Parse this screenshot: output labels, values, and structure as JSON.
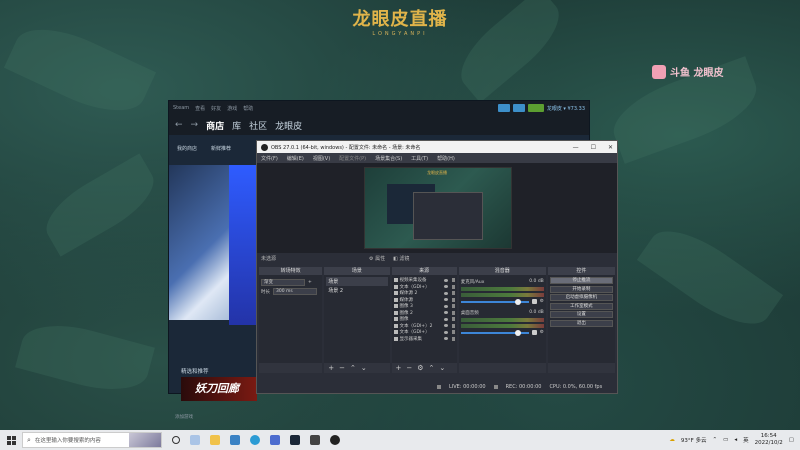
{
  "brand": {
    "title": "龙眼皮直播",
    "subtitle": "LONGYANPI"
  },
  "douyu": {
    "label": "斗鱼 龙眼皮"
  },
  "steam": {
    "menubar": [
      "Steam",
      "查看",
      "好友",
      "游戏",
      "帮助"
    ],
    "user_label": "龙眼皮 ▾ ¥73.33",
    "nav": {
      "back": "←",
      "forward": "→",
      "tabs": [
        "商店",
        "库",
        "社区",
        "龙眼皮"
      ]
    },
    "sub": [
      "我的商店",
      "新鲜推荐"
    ],
    "featured_label": "精选和推荐",
    "banner_text": "妖刀回廊",
    "add_game": "添加游戏"
  },
  "obs": {
    "title": "OBS 27.0.1 (64-bit, windows) - 配置文件: 未命名 - 场景: 未命名",
    "window_controls": [
      "—",
      "☐",
      "✕"
    ],
    "menu": [
      "文件(F)",
      "编辑(E)",
      "视图(V)",
      "配置文件(P)",
      "场景集合(S)",
      "工具(T)",
      "帮助(H)"
    ],
    "preview_title": "龙眼皮直播",
    "no_source": "未选源",
    "props": "⚙ 属性",
    "filters": "◧ 滤镜",
    "docks": {
      "transitions": {
        "title": "转场特效",
        "selected": "渐变",
        "duration_label": "时长",
        "duration_value": "300 ms"
      },
      "scenes": {
        "title": "场景",
        "items": [
          "场景",
          "场景 2"
        ]
      },
      "sources": {
        "title": "来源",
        "items": [
          "视频采集设备",
          "文本（GDI+）",
          "媒体源 2",
          "媒体源",
          "图像 3",
          "图像 2",
          "图像",
          "文本（GDI+）2",
          "文本（GDI+）",
          "显示器采集"
        ]
      },
      "mixer": {
        "title": "混音器",
        "channels": [
          {
            "name": "麦克风/Aux",
            "db": "0.0 dB"
          },
          {
            "name": "桌面音频",
            "db": "0.0 dB"
          }
        ]
      },
      "controls": {
        "title": "控件",
        "buttons": [
          "停止推流",
          "开始录制",
          "启动虚拟摄像机",
          "工作室模式",
          "设置",
          "退出"
        ]
      }
    },
    "foot_symbols": {
      "add": "+",
      "remove": "−",
      "up": "⌃",
      "down": "⌄",
      "gear": "⚙"
    },
    "status": {
      "live": "LIVE: 00:00:00",
      "rec": "REC: 00:00:00",
      "cpu": "CPU: 0.0%, 60.00 fps"
    }
  },
  "taskbar": {
    "search_placeholder": "在这里输入你要搜索的内容",
    "weather": "93°F 多云",
    "lang": "英",
    "time": "16:54",
    "date": "2022/10/2"
  }
}
